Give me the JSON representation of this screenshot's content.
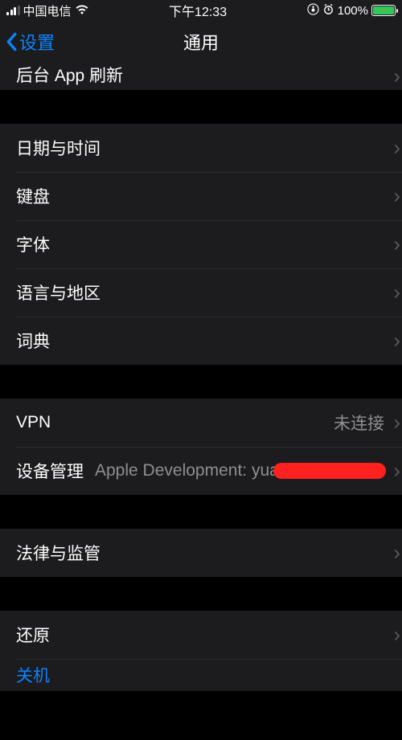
{
  "status": {
    "carrier": "中国电信",
    "time": "下午12:33",
    "battery_pct": "100%"
  },
  "nav": {
    "back": "设置",
    "title": "通用"
  },
  "rows": {
    "background_refresh": "后台 App 刷新",
    "date_time": "日期与时间",
    "keyboard": "键盘",
    "fonts": "字体",
    "language_region": "语言与地区",
    "dictionary": "词典",
    "vpn": "VPN",
    "vpn_status": "未连接",
    "device_mgmt": "设备管理",
    "device_mgmt_detail": "Apple Development: yuanzefu...",
    "legal": "法律与监管",
    "reset": "还原",
    "shutdown": "关机"
  }
}
